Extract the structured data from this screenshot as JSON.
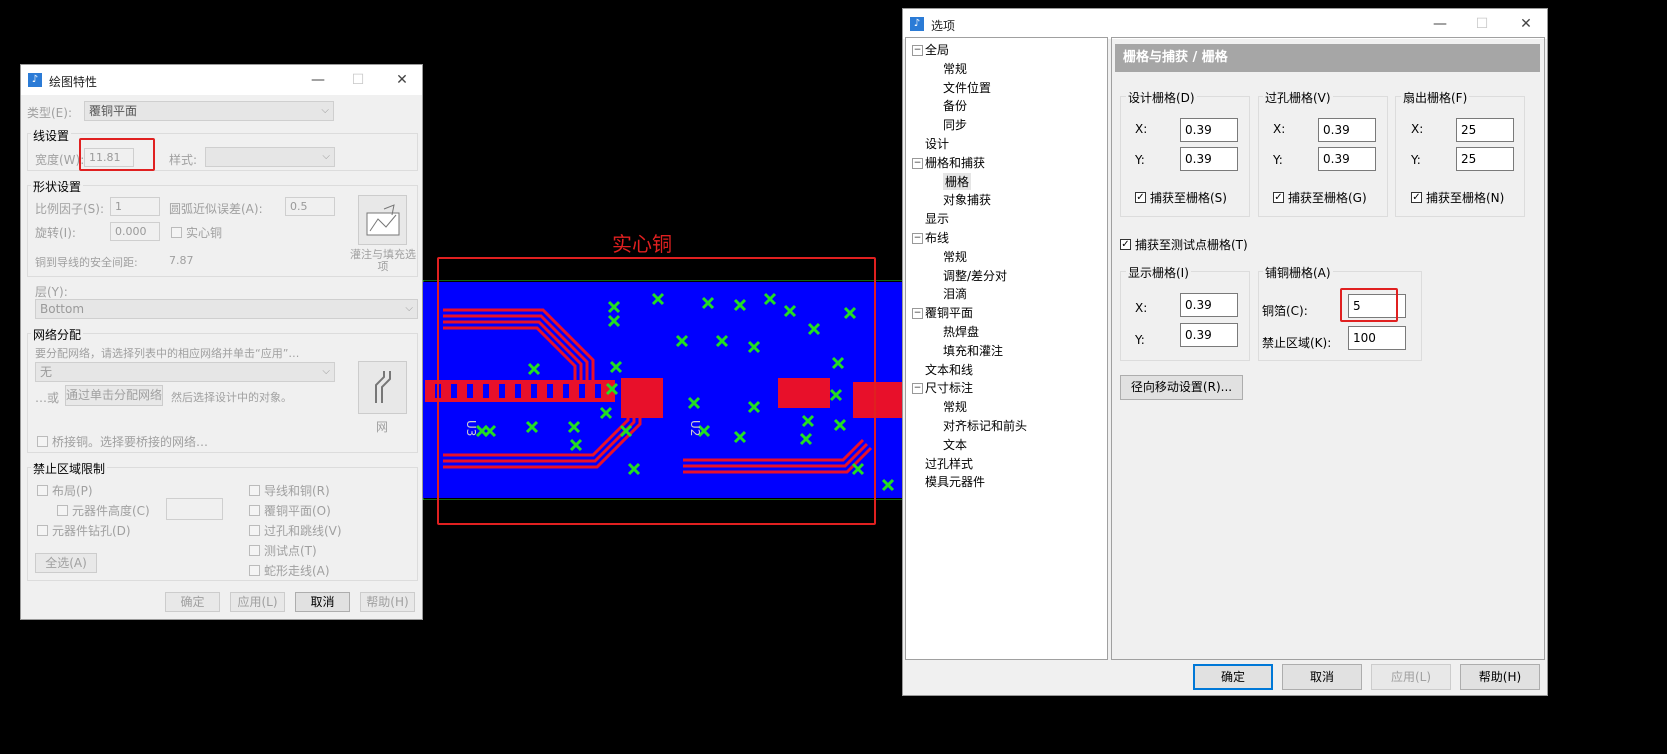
{
  "left_dialog": {
    "title": "绘图特性",
    "type_label": "类型(E):",
    "type_value": "覆铜平面",
    "line_settings": {
      "group": "线设置",
      "width_label": "宽度(W):",
      "width_value": "11.81",
      "style_label": "样式:"
    },
    "shape_settings": {
      "group": "形状设置",
      "scale_label": "比例因子(S):",
      "scale_value": "1",
      "arc_label": "圆弧近似误差(A):",
      "arc_value": "0.5",
      "rotation_label": "旋转(I):",
      "rotation_value": "0.000",
      "solid_copper": "实心铜",
      "clearance_label": "铜到导线的安全间距:",
      "clearance_value": "7.87",
      "fill_button_label": "灌注与填充选项"
    },
    "layer_label": "层(Y):",
    "layer_value": "Bottom",
    "net_assign": {
      "group": "网络分配",
      "hint": "要分配网络，请选择列表中的相应网络并单击“应用”…",
      "net_value": "无",
      "or_text": "…或",
      "click_assign_button": "通过单击分配网络",
      "then_text": "然后选择设计中的对象。",
      "net_button_label": "网",
      "bridge_copper": "桥接铜。选择要桥接的网络…"
    },
    "keepout": {
      "group": "禁止区域限制",
      "placement": "布局(P)",
      "component_height": "元器件高度(C)",
      "component_drill": "元器件钻孔(D)",
      "traces_copper": "导线和铜(R)",
      "copper_plane": "覆铜平面(O)",
      "vias_jumpers": "过孔和跳线(V)",
      "test_points": "测试点(T)",
      "serpentine": "蛇形走线(A)",
      "select_all": "全选(A)"
    },
    "buttons": {
      "ok": "确定",
      "apply": "应用(L)",
      "cancel": "取消",
      "help": "帮助(H)"
    }
  },
  "annotation": {
    "solid_copper_label": "实心铜",
    "ref_u3": "U3",
    "ref_u2": "U2"
  },
  "right_dialog": {
    "title": "选项",
    "tree": [
      {
        "label": "全局",
        "level": 0,
        "toggle": "−"
      },
      {
        "label": "常规",
        "level": 1
      },
      {
        "label": "文件位置",
        "level": 1
      },
      {
        "label": "备份",
        "level": 1
      },
      {
        "label": "同步",
        "level": 1
      },
      {
        "label": "设计",
        "level": 0
      },
      {
        "label": "栅格和捕获",
        "level": 0,
        "toggle": "−"
      },
      {
        "label": "栅格",
        "level": 1,
        "selected": true
      },
      {
        "label": "对象捕获",
        "level": 1
      },
      {
        "label": "显示",
        "level": 0
      },
      {
        "label": "布线",
        "level": 0,
        "toggle": "−"
      },
      {
        "label": "常规",
        "level": 1
      },
      {
        "label": "调整/差分对",
        "level": 1
      },
      {
        "label": "泪滴",
        "level": 1
      },
      {
        "label": "覆铜平面",
        "level": 0,
        "toggle": "−"
      },
      {
        "label": "热焊盘",
        "level": 1
      },
      {
        "label": "填充和灌注",
        "level": 1
      },
      {
        "label": "文本和线",
        "level": 0
      },
      {
        "label": "尺寸标注",
        "level": 0,
        "toggle": "−"
      },
      {
        "label": "常规",
        "level": 1
      },
      {
        "label": "对齐标记和前头",
        "level": 1
      },
      {
        "label": "文本",
        "level": 1
      },
      {
        "label": "过孔样式",
        "level": 0
      },
      {
        "label": "模具元器件",
        "level": 0
      }
    ],
    "header": "栅格与捕获 / 栅格",
    "design_grid": {
      "group": "设计栅格(D)",
      "x_label": "X:",
      "x": "0.39",
      "y_label": "Y:",
      "y": "0.39",
      "snap": "捕获至栅格(S)"
    },
    "via_grid": {
      "group": "过孔栅格(V)",
      "x_label": "X:",
      "x": "0.39",
      "y_label": "Y:",
      "y": "0.39",
      "snap": "捕获至栅格(G)"
    },
    "fanout_grid": {
      "group": "扇出栅格(F)",
      "x_label": "X:",
      "x": "25",
      "y_label": "Y:",
      "y": "25",
      "snap": "捕获至栅格(N)"
    },
    "snap_testpoint": "捕获至测试点栅格(T)",
    "display_grid": {
      "group": "显示栅格(I)",
      "x_label": "X:",
      "x": "0.39",
      "y_label": "Y:",
      "y": "0.39"
    },
    "copper_grid": {
      "group": "铺铜栅格(A)",
      "copper_label": "铜箔(C):",
      "copper_value": "5",
      "keepout_label": "禁止区域(K):",
      "keepout_value": "100"
    },
    "radial_move": "径向移动设置(R)...",
    "buttons": {
      "ok": "确定",
      "cancel": "取消",
      "apply": "应用(L)",
      "help": "帮助(H)"
    }
  },
  "colors": {
    "board_blue": "#0000ff",
    "trace_red": "#e8102a",
    "via_green": "#22dd22",
    "annotation_red": "#e02020"
  }
}
